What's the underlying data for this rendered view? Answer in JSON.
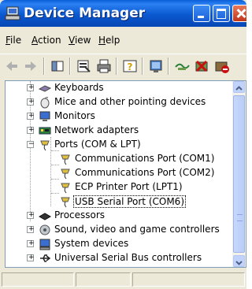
{
  "window": {
    "title": "Device Manager"
  },
  "menu": [
    {
      "label": "File",
      "hotkey": "F",
      "rest": "ile"
    },
    {
      "label": "Action",
      "hotkey": "A",
      "rest": "ction"
    },
    {
      "label": "View",
      "hotkey": "V",
      "rest": "iew"
    },
    {
      "label": "Help",
      "hotkey": "H",
      "rest": "elp"
    }
  ],
  "toolbar": {
    "buttons": [
      "back-icon",
      "forward-icon",
      "show-hide-tree-icon",
      "properties-icon",
      "print-icon",
      "help-icon",
      "scan-hardware-icon",
      "update-driver-icon",
      "uninstall-icon",
      "disable-icon"
    ]
  },
  "tree": {
    "nodes": [
      {
        "label": "Keyboards",
        "expander": "+",
        "icon": "keyboard-icon"
      },
      {
        "label": "Mice and other pointing devices",
        "expander": "+",
        "icon": "mouse-icon"
      },
      {
        "label": "Monitors",
        "expander": "+",
        "icon": "monitor-icon"
      },
      {
        "label": "Network adapters",
        "expander": "+",
        "icon": "network-adapter-icon"
      },
      {
        "label": "Ports (COM & LPT)",
        "expander": "−",
        "icon": "port-icon"
      },
      {
        "label": "Communications Port (COM1)",
        "icon": "port-icon"
      },
      {
        "label": "Communications Port (COM2)",
        "icon": "port-icon"
      },
      {
        "label": "ECP Printer Port (LPT1)",
        "icon": "port-icon"
      },
      {
        "label": "USB Serial Port (COM6)",
        "icon": "port-icon",
        "selected": true
      },
      {
        "label": "Processors",
        "expander": "+",
        "icon": "processor-icon"
      },
      {
        "label": "Sound, video and game controllers",
        "expander": "+",
        "icon": "sound-icon"
      },
      {
        "label": "System devices",
        "expander": "+",
        "icon": "system-devices-icon"
      },
      {
        "label": "Universal Serial Bus controllers",
        "expander": "+",
        "icon": "usb-icon"
      }
    ]
  },
  "colors": {
    "titlebar": "#0a58d0",
    "window_bg": "#ece9d8",
    "close_button": "#c2351a"
  }
}
